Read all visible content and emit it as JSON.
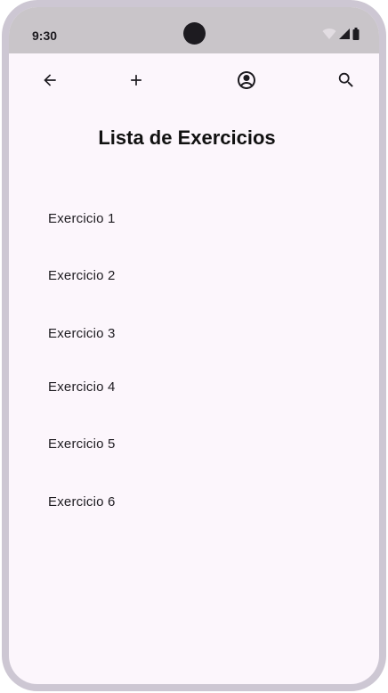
{
  "status_bar": {
    "time": "9:30",
    "icons": [
      "wifi-icon",
      "signal-icon",
      "battery-icon"
    ]
  },
  "app_bar": {
    "actions": [
      "back-arrow-icon",
      "add-icon",
      "account-circle-icon",
      "search-icon"
    ]
  },
  "page": {
    "title": "Lista de Exercicios"
  },
  "exercises": [
    "Exercicio 1",
    "Exercicio 2",
    "Exercicio 3",
    "Exercicio 4",
    "Exercicio 5",
    "Exercicio 6"
  ]
}
